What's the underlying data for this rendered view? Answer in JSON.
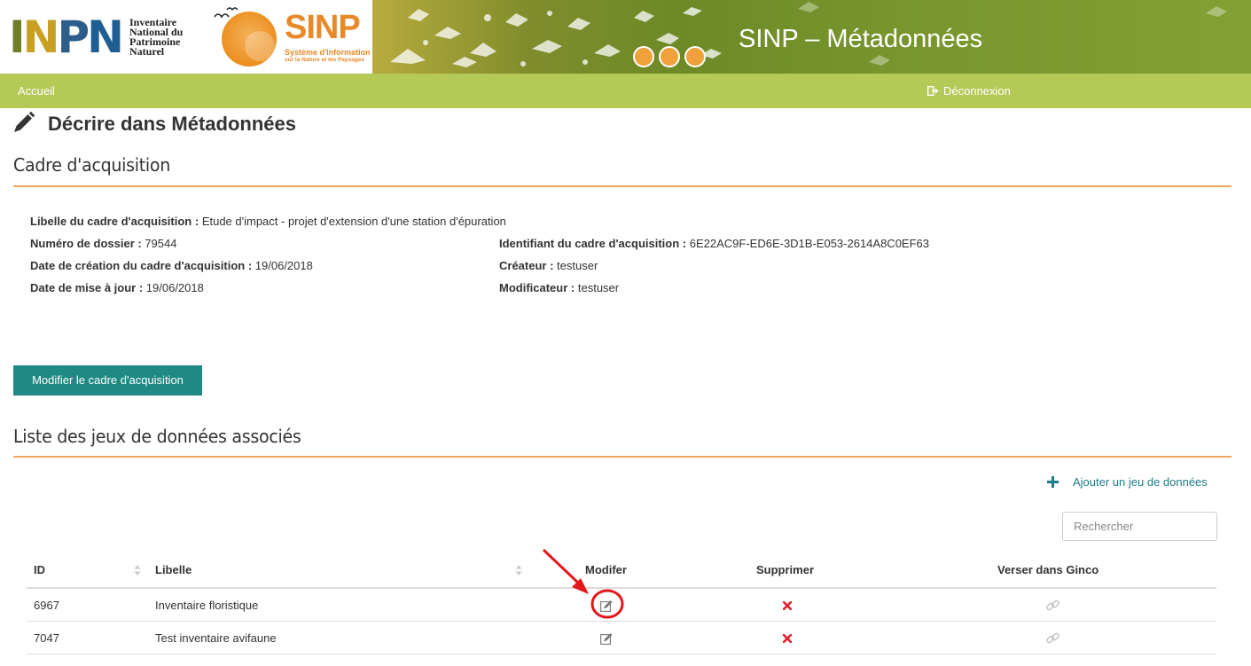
{
  "header": {
    "inpn_letters": "INPN",
    "inpn_text_lines": [
      "Inventaire",
      "National du",
      "Patrimoine",
      "Naturel"
    ],
    "sinp_title": "SINP",
    "sinp_subtitle_1": "Système d'Information",
    "sinp_subtitle_2": "sur la Nature et les Paysages",
    "app_title": "SINP – Métadonnées"
  },
  "nav": {
    "home_label": "Accueil",
    "logout_label": "Déconnexion",
    "logout_icon": "sign-out-icon"
  },
  "page": {
    "heading": "Décrire dans Métadonnées",
    "heading_icon": "pencil-icon"
  },
  "acquisition": {
    "section_title": "Cadre d'acquisition",
    "fields": {
      "libelle": {
        "label": "Libelle du cadre d'acquisition :",
        "value": "Etude d'impact - projet d'extension d'une station d'épuration"
      },
      "numero": {
        "label": "Numéro de dossier :",
        "value": "79544"
      },
      "date_creation": {
        "label": "Date de création du cadre d'acquisition :",
        "value": "19/06/2018"
      },
      "date_maj": {
        "label": "Date de mise à jour :",
        "value": "19/06/2018"
      },
      "identifiant": {
        "label": "Identifiant du cadre d'acquisition :",
        "value": "6E22AC9F-ED6E-3D1B-E053-2614A8C0EF63"
      },
      "createur": {
        "label": "Créateur :",
        "value": "testuser"
      },
      "modificateur": {
        "label": "Modificateur :",
        "value": "testuser"
      }
    },
    "modify_button_label": "Modifier le cadre d'acquisition"
  },
  "datasets": {
    "section_title": "Liste des jeux de données associés",
    "add_label": "Ajouter un jeu de données",
    "add_icon": "plus-icon",
    "search_placeholder": "Rechercher",
    "columns": {
      "id": "ID",
      "libelle": "Libelle",
      "modifier": "Modifer",
      "supprimer": "Supprimer",
      "verser": "Verser dans Ginco"
    },
    "rows": [
      {
        "id": "6967",
        "libelle": "Inventaire floristique"
      },
      {
        "id": "7047",
        "libelle": "Test inventaire avifaune"
      }
    ]
  },
  "colors": {
    "navbar": "#b5c957",
    "accent_rule": "#f0a760",
    "primary_button": "#1e8a83",
    "link": "#1e7b87",
    "delete": "#e2222e",
    "annotation": "#e5161b"
  }
}
